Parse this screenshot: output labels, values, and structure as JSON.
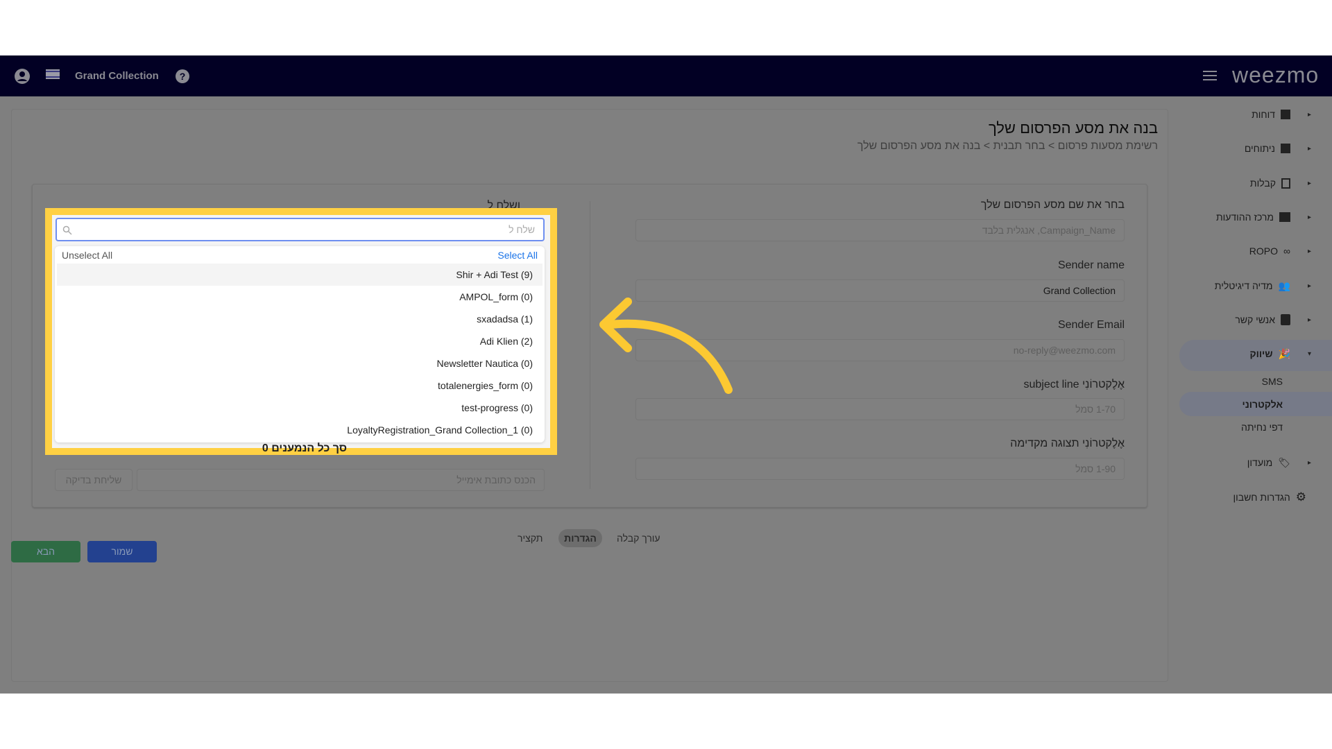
{
  "header": {
    "account": "Grand Collection",
    "logo": "weezmo",
    "icons": [
      "user-icon",
      "flag-icon",
      "help-icon",
      "menu-icon"
    ]
  },
  "page": {
    "title": "בנה את מסע הפרסום שלך",
    "breadcrumb": [
      "רשימת מסעות פרסום",
      "בחר תבנית",
      "בנה את מסע הפרסום שלך"
    ],
    "breadcrumb_sep": ">"
  },
  "form": {
    "campaign_name": {
      "label": "בחר את שם מסע הפרסום שלך",
      "placeholder": "Campaign_Name, אנגלית בלבד"
    },
    "sender_name": {
      "label": "Sender name",
      "value": "Grand Collection"
    },
    "sender_email": {
      "label": "Sender Email",
      "placeholder": "no-reply@weezmo.com"
    },
    "subject": {
      "label": "אֶלֶקטרוֹנִי subject line",
      "placeholder": "1-70 סמל"
    },
    "preview": {
      "label": "אֶלֶקטרוֹנִי תצוגה מקדימה",
      "placeholder": "1-90 סמל"
    },
    "send_to_label": "ושלח ל",
    "total_hidden": "סך כל הנמענים 0",
    "test_email_placeholder": "הכנס כתובת אימייל",
    "test_send": "שליחת בדיקה"
  },
  "dropdown": {
    "search_placeholder": "שלח ל",
    "unselect_all": "Unselect All",
    "select_all": "Select All",
    "items": [
      "Shir + Adi Test (9)",
      "AMPOL_form (0)",
      "sxadadsa (1)",
      "Adi Klien (2)",
      "Newsletter Nautica (0)",
      "totalenergies_form (0)",
      "test-progress (0)",
      "LoyaltyRegistration_Grand Collection_1 (0)"
    ]
  },
  "tabs": [
    {
      "label": "עורך קבלה"
    },
    {
      "label": "הגדרות",
      "active": true
    },
    {
      "label": "תקציר"
    }
  ],
  "buttons": {
    "next": "הבא",
    "save": "שמור"
  },
  "sidebar": {
    "items": [
      {
        "label": "דוחות"
      },
      {
        "label": "ניתוחים"
      },
      {
        "label": "קבלות"
      },
      {
        "label": "מרכז ההודעות"
      },
      {
        "label": "ROPO"
      },
      {
        "label": "מדיה דיגיטלית"
      },
      {
        "label": "אנשי קשר"
      },
      {
        "label": "שיווק",
        "expanded": true
      }
    ],
    "sub": [
      {
        "label": "SMS"
      },
      {
        "label": "אלקטרוני",
        "active": true
      },
      {
        "label": "דפי נחיתה"
      }
    ],
    "after": [
      {
        "label": "מועדון"
      },
      {
        "label": "הגדרות חשבון"
      }
    ]
  },
  "colors": {
    "nav": "#020024",
    "highlight": "#ffd043",
    "select_all": "#1a73e8",
    "next": "#2e6b44",
    "save": "#23418f"
  }
}
